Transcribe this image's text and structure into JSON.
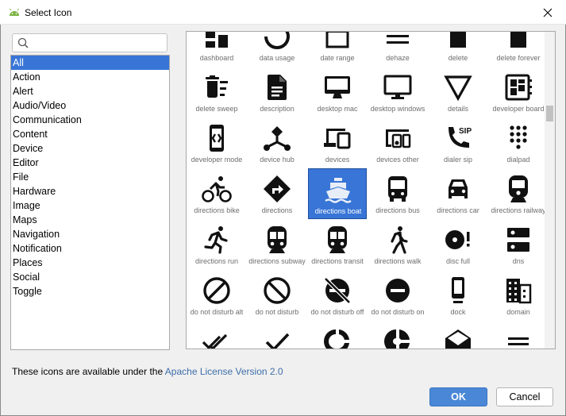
{
  "window": {
    "title": "Select Icon"
  },
  "search": {
    "value": "",
    "placeholder": ""
  },
  "categories": {
    "selected": "All",
    "items": [
      "All",
      "Action",
      "Alert",
      "Audio/Video",
      "Communication",
      "Content",
      "Device",
      "Editor",
      "File",
      "Hardware",
      "Image",
      "Maps",
      "Navigation",
      "Notification",
      "Places",
      "Social",
      "Toggle"
    ]
  },
  "icons": {
    "selected": "directions boat",
    "accent_color": "#3875d7",
    "items": [
      {
        "label": "dashboard",
        "icon": "dashboard-icon"
      },
      {
        "label": "data usage",
        "icon": "data-usage-icon"
      },
      {
        "label": "date range",
        "icon": "date-range-icon"
      },
      {
        "label": "dehaze",
        "icon": "dehaze-icon"
      },
      {
        "label": "delete",
        "icon": "delete-icon"
      },
      {
        "label": "delete forever",
        "icon": "delete-forever-icon"
      },
      {
        "label": "delete sweep",
        "icon": "delete-sweep-icon"
      },
      {
        "label": "description",
        "icon": "description-icon"
      },
      {
        "label": "desktop mac",
        "icon": "desktop-mac-icon"
      },
      {
        "label": "desktop windows",
        "icon": "desktop-windows-icon"
      },
      {
        "label": "details",
        "icon": "details-icon"
      },
      {
        "label": "developer board",
        "icon": "developer-board-icon"
      },
      {
        "label": "developer mode",
        "icon": "developer-mode-icon"
      },
      {
        "label": "device hub",
        "icon": "device-hub-icon"
      },
      {
        "label": "devices",
        "icon": "devices-icon"
      },
      {
        "label": "devices other",
        "icon": "devices-other-icon"
      },
      {
        "label": "dialer sip",
        "icon": "dialer-sip-icon"
      },
      {
        "label": "dialpad",
        "icon": "dialpad-icon"
      },
      {
        "label": "directions bike",
        "icon": "directions-bike-icon"
      },
      {
        "label": "directions",
        "icon": "directions-icon"
      },
      {
        "label": "directions boat",
        "icon": "directions-boat-icon"
      },
      {
        "label": "directions bus",
        "icon": "directions-bus-icon"
      },
      {
        "label": "directions car",
        "icon": "directions-car-icon"
      },
      {
        "label": "directions railway",
        "icon": "directions-railway-icon"
      },
      {
        "label": "directions run",
        "icon": "directions-run-icon"
      },
      {
        "label": "directions subway",
        "icon": "directions-subway-icon"
      },
      {
        "label": "directions transit",
        "icon": "directions-transit-icon"
      },
      {
        "label": "directions walk",
        "icon": "directions-walk-icon"
      },
      {
        "label": "disc full",
        "icon": "disc-full-icon"
      },
      {
        "label": "dns",
        "icon": "dns-icon"
      },
      {
        "label": "do not disturb alt",
        "icon": "do-not-disturb-alt-icon"
      },
      {
        "label": "do not disturb",
        "icon": "do-not-disturb-icon"
      },
      {
        "label": "do not disturb off",
        "icon": "do-not-disturb-off-icon"
      },
      {
        "label": "do not disturb on",
        "icon": "do-not-disturb-on-icon"
      },
      {
        "label": "dock",
        "icon": "dock-icon"
      },
      {
        "label": "domain",
        "icon": "domain-icon"
      },
      {
        "label": "done all",
        "icon": "done-all-icon"
      },
      {
        "label": "done",
        "icon": "done-icon"
      },
      {
        "label": "donut large",
        "icon": "donut-large-icon"
      },
      {
        "label": "donut small",
        "icon": "donut-small-icon"
      },
      {
        "label": "drafts",
        "icon": "drafts-icon"
      },
      {
        "label": "drag handle",
        "icon": "drag-handle-icon"
      }
    ]
  },
  "footer": {
    "license_prefix": "These icons are available under the ",
    "license_link": "Apache License Version 2.0"
  },
  "buttons": {
    "ok": "OK",
    "cancel": "Cancel"
  }
}
